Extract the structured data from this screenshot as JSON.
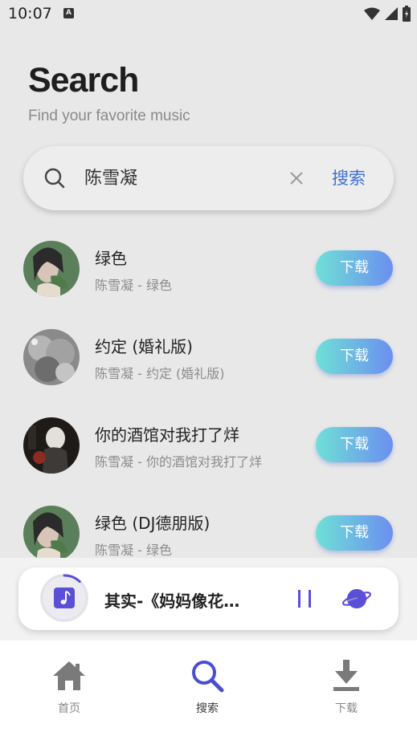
{
  "status_bar": {
    "time": "10:07",
    "notification_glyph": "A"
  },
  "header": {
    "title": "Search",
    "subtitle": "Find your favorite music"
  },
  "search": {
    "query": "陈雪凝",
    "button_label": "搜索"
  },
  "results": [
    {
      "title": "绿色",
      "subtitle": "陈雪凝 - 绿色",
      "download_label": "下载",
      "cover": "green-portrait"
    },
    {
      "title": "约定 (婚礼版)",
      "subtitle": "陈雪凝 - 约定 (婚礼版)",
      "download_label": "下载",
      "cover": "grey-clouds"
    },
    {
      "title": "你的酒馆对我打了烊",
      "subtitle": "陈雪凝 - 你的酒馆对我打了烊",
      "download_label": "下载",
      "cover": "dark-photo"
    },
    {
      "title": "绿色 (DJ德朋版)",
      "subtitle": "陈雪凝 - 绿色",
      "download_label": "下载",
      "cover": "green-portrait"
    }
  ],
  "player": {
    "now_playing": "其实-《妈妈像花…",
    "progress": 0.12
  },
  "nav": {
    "home": "首页",
    "search": "搜索",
    "download": "下载"
  },
  "colors": {
    "accent": "#3f6fd6",
    "player_purple": "#5a4fd6",
    "download_gradient_start": "#6ee0d6",
    "download_gradient_end": "#6c8ff0"
  }
}
